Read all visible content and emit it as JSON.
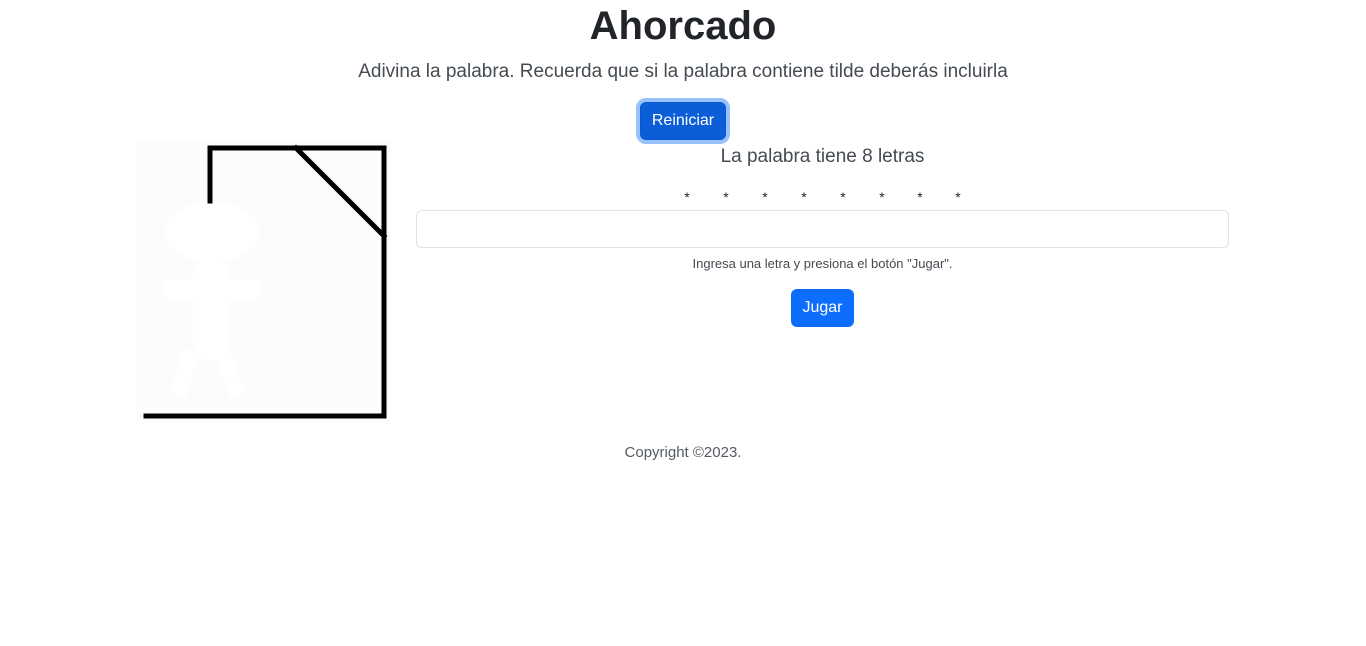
{
  "header": {
    "title": "Ahorcado",
    "subtitle": "Adivina la palabra. Recuerda que si la palabra contiene tilde deberás incluirla"
  },
  "controls": {
    "reset_label": "Reiniciar",
    "play_label": "Jugar"
  },
  "game": {
    "word_length_text": "La palabra tiene 8 letras",
    "masked_letters": [
      "*",
      "*",
      "*",
      "*",
      "*",
      "*",
      "*",
      "*"
    ],
    "input_value": "",
    "help_text": "Ingresa una letra y presiona el botón \"Jugar\"."
  },
  "hangman_image": {
    "icon": "hangman-gallows-icon",
    "errors": 0
  },
  "colors": {
    "primary": "#0d6efd",
    "text": "#212529"
  },
  "footer": {
    "copyright": "Copyright ©2023."
  }
}
